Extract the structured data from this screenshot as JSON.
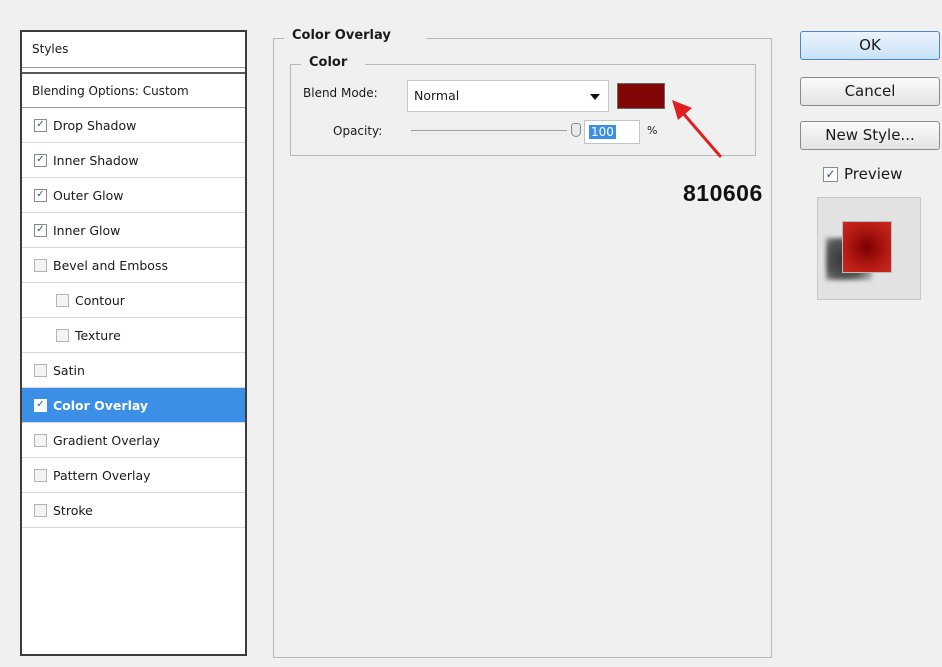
{
  "styles_panel": {
    "header": "Styles",
    "blending": "Blending Options: Custom",
    "items": [
      {
        "label": "Drop Shadow",
        "checked": true
      },
      {
        "label": "Inner Shadow",
        "checked": true
      },
      {
        "label": "Outer Glow",
        "checked": true
      },
      {
        "label": "Inner Glow",
        "checked": true
      },
      {
        "label": "Bevel and Emboss",
        "checked": false
      },
      {
        "label": "Contour",
        "checked": false
      },
      {
        "label": "Texture",
        "checked": false
      },
      {
        "label": "Satin",
        "checked": false
      },
      {
        "label": "Color Overlay",
        "checked": true,
        "selected": true
      },
      {
        "label": "Gradient Overlay",
        "checked": false
      },
      {
        "label": "Pattern Overlay",
        "checked": false
      },
      {
        "label": "Stroke",
        "checked": false
      }
    ]
  },
  "color_overlay": {
    "title": "Color Overlay",
    "color_group_title": "Color",
    "blend_mode_label": "Blend Mode:",
    "blend_mode_value": "Normal",
    "swatch_color": "#810606",
    "opacity_label": "Opacity:",
    "opacity_value": "100",
    "opacity_unit": "%",
    "opacity_fraction": 1.0
  },
  "annotation": {
    "text": "810606",
    "arrow_color": "#e02020"
  },
  "buttons": {
    "ok": "OK",
    "cancel": "Cancel",
    "new_style": "New Style...",
    "preview_label": "Preview",
    "preview_checked": true
  },
  "colors": {
    "selection": "#3b8fe6",
    "overlay_red": "#810606"
  }
}
